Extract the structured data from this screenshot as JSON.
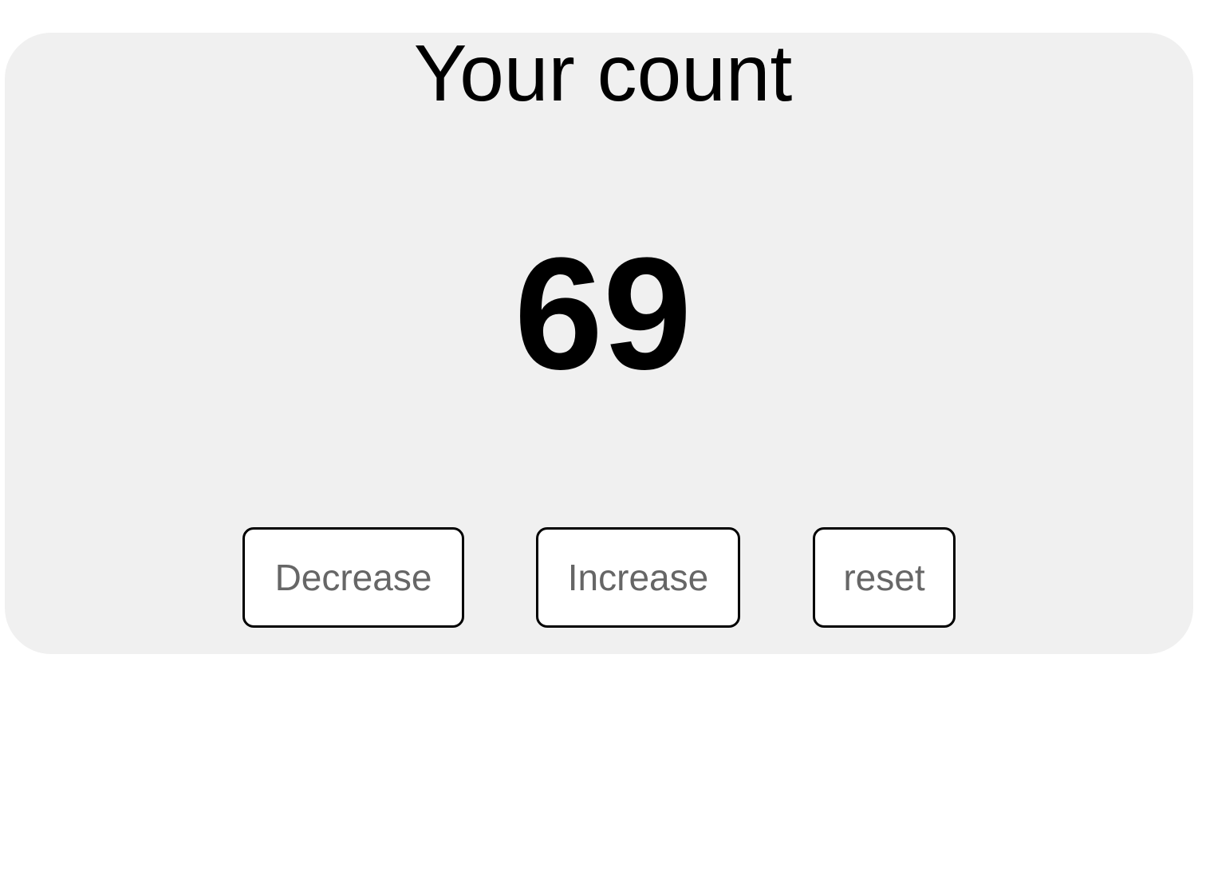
{
  "counter": {
    "title": "Your count",
    "value": "69"
  },
  "buttons": {
    "decrease_label": "Decrease",
    "increase_label": "Increase",
    "reset_label": "reset"
  },
  "colors": {
    "card_background": "#f0f0f0",
    "button_text": "#666666",
    "button_border": "#000000",
    "text": "#000000"
  }
}
